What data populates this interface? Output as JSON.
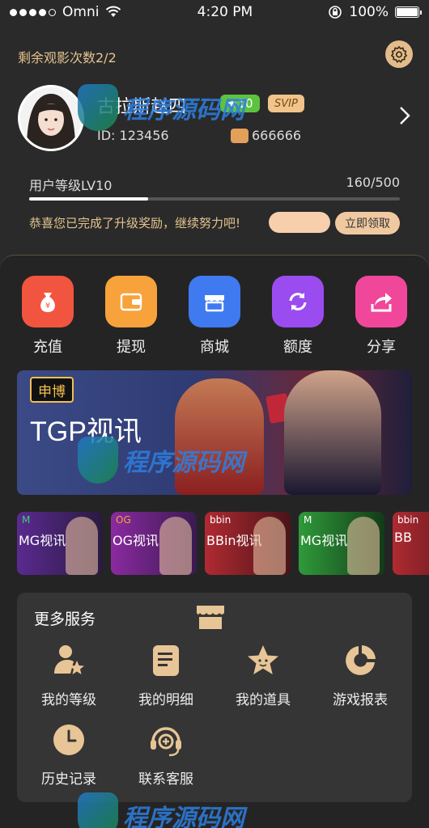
{
  "status": {
    "carrier": "Omni",
    "time": "4:20 PM",
    "battery": "100%",
    "battery_level": 1.0
  },
  "profile": {
    "remaining_views": "剩余观影次数2/2",
    "username": "古拉斯赵四",
    "level_badge": "★10",
    "svip": "SVIP",
    "user_id": "ID: 123456",
    "invite_code": "666666",
    "exp_label": "用户等级LV10",
    "exp_value": "160/500",
    "exp_progress": 0.32,
    "congrats": "恭喜您已完成了升级奖励，继续努力吧!",
    "claim_button": "立即领取"
  },
  "quick_actions": [
    {
      "label": "充值",
      "icon": "money-bag-icon",
      "color": "#f2553f"
    },
    {
      "label": "提现",
      "icon": "wallet-icon",
      "color": "#f7a23a"
    },
    {
      "label": "商城",
      "icon": "store-icon",
      "color": "#3f7af0"
    },
    {
      "label": "额度",
      "icon": "refresh-icon",
      "color": "#9b4cf0"
    },
    {
      "label": "分享",
      "icon": "share-icon",
      "color": "#f0479a"
    }
  ],
  "banner": {
    "tag": "申博",
    "title": "TGP视讯"
  },
  "games": [
    {
      "label": "MG视讯",
      "logo": "M",
      "color": "#6a2fa0"
    },
    {
      "label": "OG视讯",
      "logo": "OG",
      "color": "#7a2a9a"
    },
    {
      "label": "BBin视讯",
      "logo": "bbin",
      "color": "#a0242e"
    },
    {
      "label": "MG视讯",
      "logo": "M",
      "color": "#2f8a3a"
    },
    {
      "label": "BB",
      "logo": "bbin",
      "color": "#a0242e"
    }
  ],
  "services": {
    "title": "更多服务",
    "items": [
      {
        "label": "我的等级",
        "icon": "user-star-icon"
      },
      {
        "label": "我的明细",
        "icon": "document-icon"
      },
      {
        "label": "我的道具",
        "icon": "star-icon"
      },
      {
        "label": "游戏报表",
        "icon": "pie-chart-icon"
      },
      {
        "label": "历史记录",
        "icon": "clock-icon"
      },
      {
        "label": "联系客服",
        "icon": "headset-icon"
      }
    ]
  },
  "watermark": {
    "text": "程序源码网"
  },
  "colors": {
    "accent": "#e4c48f",
    "background": "#2a2a2a",
    "panel": "#252424",
    "gold_icon": "#e8c596"
  }
}
